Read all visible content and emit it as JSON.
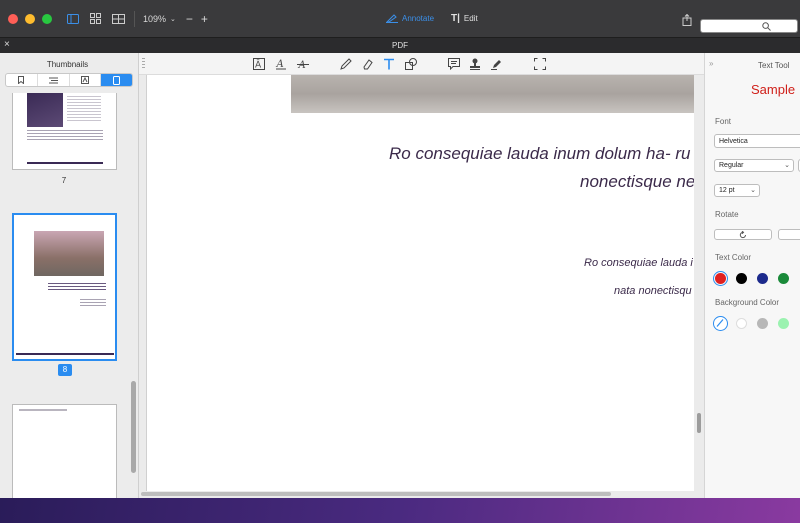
{
  "toolbar": {
    "zoom": "109%",
    "zoom_out": "−",
    "zoom_in": "+",
    "annotate_label": "Annotate",
    "edit_label": "Edit"
  },
  "tab": {
    "title": "PDF",
    "close": "×"
  },
  "sidebar": {
    "title": "Thumbnails",
    "pages": [
      {
        "number": "7",
        "selected": false
      },
      {
        "number": "8",
        "selected": true
      }
    ]
  },
  "document": {
    "line1": "Ro consequiae lauda inum dolum ha- ru",
    "line2": "nonectisque ne",
    "line3": "Ro consequiae lauda i",
    "line4": "nata nonectisqu"
  },
  "text_tool": {
    "title": "Text Tool",
    "sample": "Sample",
    "font_label": "Font",
    "font_value": "Helvetica",
    "style_value": "Regular",
    "size_value": "12 pt",
    "rotate_label": "Rotate",
    "text_color_label": "Text Color",
    "text_colors": [
      "#e0201f",
      "#000000",
      "#1c2a8c",
      "#1a8a3a"
    ],
    "bg_color_label": "Background Color",
    "bg_colors": [
      "#ffffff",
      "#b7b7b7",
      "#9bf2b0"
    ]
  },
  "colors": {
    "accent": "#2a8cf0",
    "close": "#ff5f57",
    "minimize": "#febc2e",
    "zoom": "#28c840",
    "sample_red": "#d0201a"
  }
}
